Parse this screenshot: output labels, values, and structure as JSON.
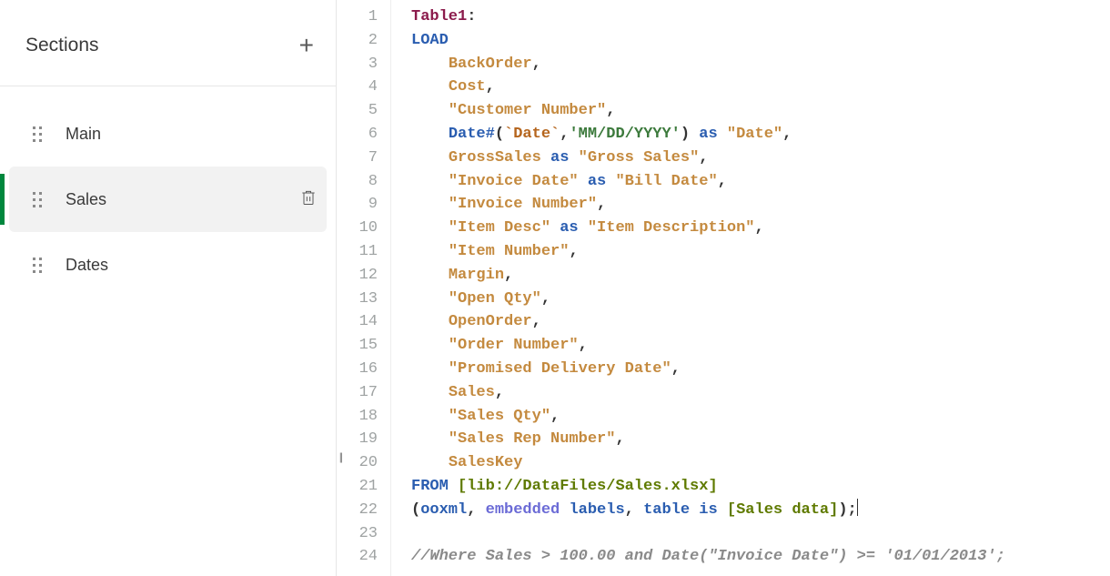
{
  "sidebar": {
    "title": "Sections",
    "items": [
      {
        "label": "Main",
        "active": false
      },
      {
        "label": "Sales",
        "active": true
      },
      {
        "label": "Dates",
        "active": false
      }
    ]
  },
  "editor": {
    "lineCount": 24,
    "script": {
      "tableName": "Table1",
      "loadKeyword": "LOAD",
      "fields": [
        {
          "text": "BackOrder",
          "type": "plain"
        },
        {
          "text": "Cost",
          "type": "plain"
        },
        {
          "text": "\"Customer Number\"",
          "type": "quoted"
        },
        {
          "text": "Date#(`Date`,'MM/DD/YYYY') as \"Date\"",
          "type": "expr"
        },
        {
          "text": "GrossSales as \"Gross Sales\"",
          "type": "alias"
        },
        {
          "text": "\"Invoice Date\" as \"Bill Date\"",
          "type": "alias"
        },
        {
          "text": "\"Invoice Number\"",
          "type": "quoted"
        },
        {
          "text": "\"Item Desc\" as \"Item Description\"",
          "type": "alias"
        },
        {
          "text": "\"Item Number\"",
          "type": "quoted"
        },
        {
          "text": "Margin",
          "type": "plain"
        },
        {
          "text": "\"Open Qty\"",
          "type": "quoted"
        },
        {
          "text": "OpenOrder",
          "type": "plain"
        },
        {
          "text": "\"Order Number\"",
          "type": "quoted"
        },
        {
          "text": "\"Promised Delivery Date\"",
          "type": "quoted"
        },
        {
          "text": "Sales",
          "type": "plain"
        },
        {
          "text": "\"Sales Qty\"",
          "type": "quoted"
        },
        {
          "text": "\"Sales Rep Number\"",
          "type": "quoted"
        },
        {
          "text": "SalesKey",
          "type": "plain",
          "last": true
        }
      ],
      "fromKeyword": "FROM",
      "fromPath": "[lib://DataFiles/Sales.xlsx]",
      "formatSpec": "(ooxml, embedded labels, table is [Sales data]);",
      "comment": "//Where Sales > 100.00 and Date(\"Invoice Date\") >= '01/01/2013';"
    }
  }
}
